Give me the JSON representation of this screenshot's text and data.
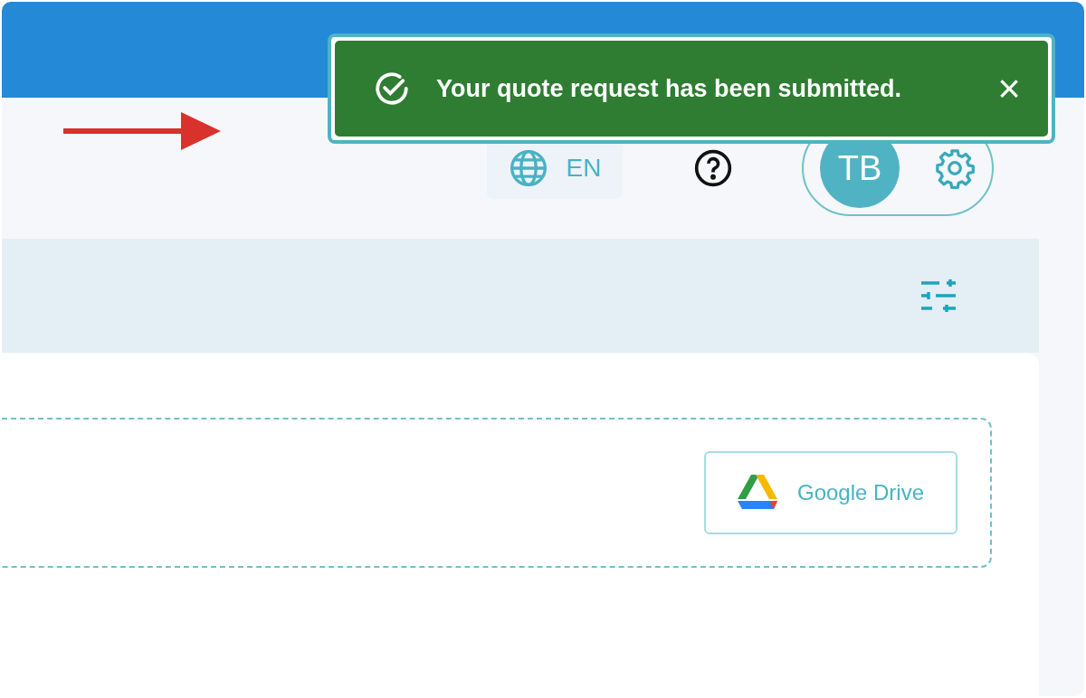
{
  "toast": {
    "message": "Your quote request has been submitted.",
    "close": "×"
  },
  "header": {
    "language": "EN",
    "avatar_initials": "TB"
  },
  "upload": {
    "button": "Google Drive"
  }
}
